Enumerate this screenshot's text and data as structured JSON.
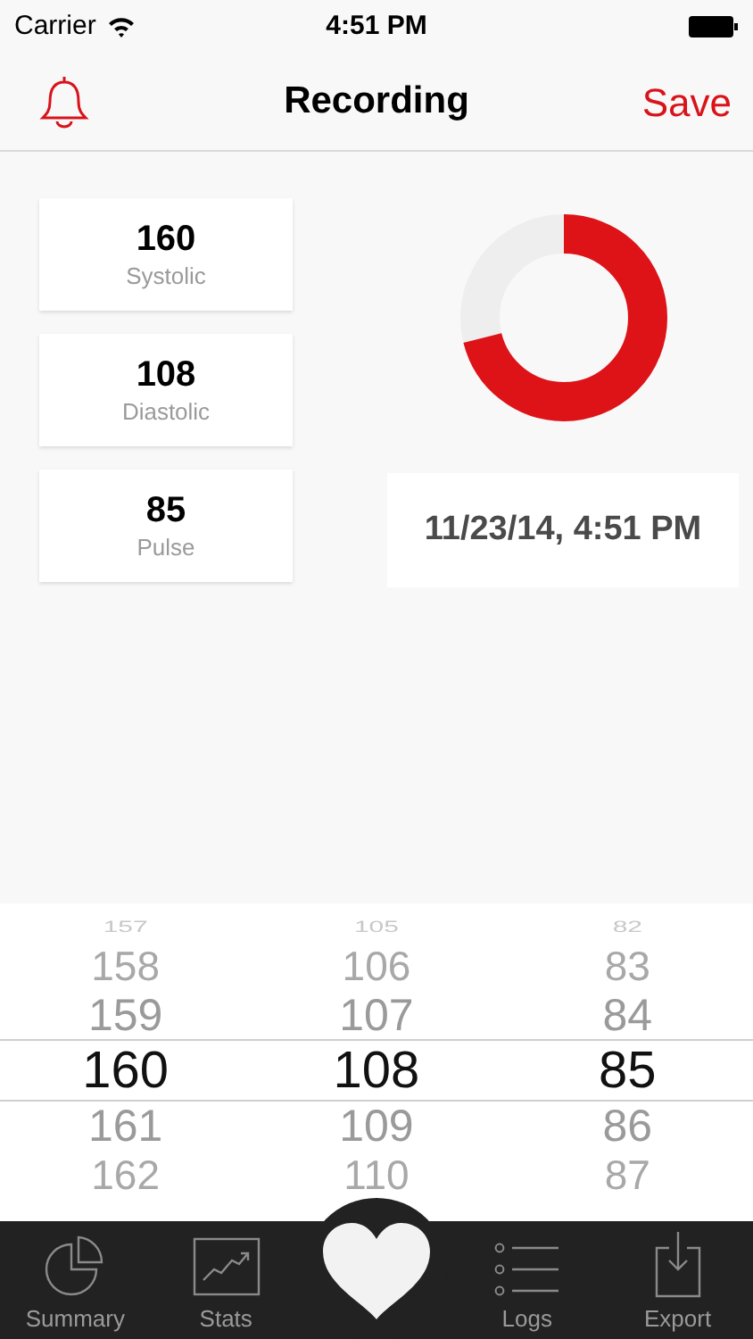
{
  "status_bar": {
    "carrier": "Carrier",
    "time": "4:51 PM"
  },
  "nav": {
    "title": "Recording",
    "action": "Save"
  },
  "readings": [
    {
      "value": "160",
      "label": "Systolic"
    },
    {
      "value": "108",
      "label": "Diastolic"
    },
    {
      "value": "85",
      "label": "Pulse"
    }
  ],
  "gauge": {
    "level": 0.71
  },
  "timestamp": "11/23/14, 4:51 PM",
  "picker": [
    {
      "items": [
        {
          "text": "157",
          "selected": false
        },
        {
          "text": "158",
          "selected": false
        },
        {
          "text": "159",
          "selected": false
        },
        {
          "text": "160",
          "selected": true
        },
        {
          "text": "161",
          "selected": false
        },
        {
          "text": "162",
          "selected": false
        }
      ]
    },
    {
      "items": [
        {
          "text": "105",
          "selected": false
        },
        {
          "text": "106",
          "selected": false
        },
        {
          "text": "107",
          "selected": false
        },
        {
          "text": "108",
          "selected": true
        },
        {
          "text": "109",
          "selected": false
        },
        {
          "text": "110",
          "selected": false
        }
      ]
    },
    {
      "items": [
        {
          "text": "82",
          "selected": false
        },
        {
          "text": "83",
          "selected": false
        },
        {
          "text": "84",
          "selected": false
        },
        {
          "text": "85",
          "selected": true
        },
        {
          "text": "86",
          "selected": false
        },
        {
          "text": "87",
          "selected": false
        }
      ]
    }
  ],
  "tab_bar": [
    {
      "kind": "summary",
      "label": "Summary"
    },
    {
      "kind": "stats",
      "label": "Stats"
    },
    {
      "kind": "heart"
    },
    {
      "kind": "logs",
      "label": "Logs"
    },
    {
      "kind": "export",
      "label": "Export"
    }
  ]
}
